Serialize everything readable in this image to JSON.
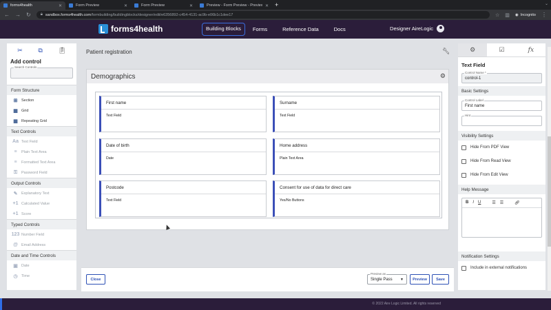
{
  "browser": {
    "tabs": [
      {
        "title": "forms4health",
        "active": true
      },
      {
        "title": "Form Preview",
        "active": false
      },
      {
        "title": "Form Preview",
        "active": false
      },
      {
        "title": "Preview - Form Preview - Preview",
        "active": false
      }
    ],
    "url_host": "sandbox.forms4health.com",
    "url_path": "/formbuilding/buildingblocks/designer/edit/e6356892-c454-4131-ac9b-e06b1c1dee17",
    "incognito_label": "Incognito"
  },
  "header": {
    "logo_text": "forms4health",
    "nav": [
      {
        "label": "Building Blocks",
        "active": true
      },
      {
        "label": "Forms",
        "active": false
      },
      {
        "label": "Reference Data",
        "active": false
      },
      {
        "label": "Docs",
        "active": false
      }
    ],
    "user_label": "Designer AireLogic"
  },
  "left": {
    "title": "Add control",
    "search_label": "Search Controls",
    "sections": [
      {
        "title": "Form Structure",
        "items": [
          {
            "label": "Section",
            "icon": "section-icon",
            "glyph": "⊞",
            "enabled": true
          },
          {
            "label": "Grid",
            "icon": "grid-icon",
            "glyph": "▦",
            "enabled": true
          },
          {
            "label": "Repeating Grid",
            "icon": "repeating-grid-icon",
            "glyph": "▦",
            "enabled": true
          }
        ]
      },
      {
        "title": "Text Controls",
        "items": [
          {
            "label": "Text Field",
            "icon": "text-field-icon",
            "glyph": "Aa",
            "enabled": false
          },
          {
            "label": "Plain Text Area",
            "icon": "plain-text-area-icon",
            "glyph": "≡",
            "enabled": false
          },
          {
            "label": "Formatted Text Area",
            "icon": "formatted-text-area-icon",
            "glyph": "≡",
            "enabled": false
          },
          {
            "label": "Password Field",
            "icon": "password-field-icon",
            "glyph": "⚿",
            "enabled": false
          }
        ]
      },
      {
        "title": "Output Controls",
        "items": [
          {
            "label": "Explanatory Text",
            "icon": "explanatory-text-icon",
            "glyph": "✎",
            "enabled": false
          },
          {
            "label": "Calculated Value",
            "icon": "calculated-value-icon",
            "glyph": "+1",
            "enabled": false
          },
          {
            "label": "Score",
            "icon": "score-icon",
            "glyph": "+1",
            "enabled": false
          }
        ]
      },
      {
        "title": "Typed Controls",
        "items": [
          {
            "label": "Number Field",
            "icon": "number-field-icon",
            "glyph": "123",
            "enabled": false
          },
          {
            "label": "Email Address",
            "icon": "email-address-icon",
            "glyph": "@",
            "enabled": false
          }
        ]
      },
      {
        "title": "Date and Time Controls",
        "items": [
          {
            "label": "Date",
            "icon": "date-icon",
            "glyph": "▣",
            "enabled": false
          },
          {
            "label": "Time",
            "icon": "time-icon",
            "glyph": "◷",
            "enabled": false
          }
        ]
      }
    ]
  },
  "main": {
    "title": "Patient registration",
    "section_title": "Demographics",
    "fields": [
      {
        "label": "First name",
        "type": "Text Field"
      },
      {
        "label": "Surname",
        "type": "Text Field"
      },
      {
        "label": "Date of birth",
        "type": "Date"
      },
      {
        "label": "Home address",
        "type": "Plain Text Area"
      },
      {
        "label": "Postcode",
        "type": "Text Field"
      },
      {
        "label": "Consent for use of data for direct care",
        "type": "Yes/No Buttons"
      }
    ]
  },
  "bottom": {
    "close_label": "Close",
    "preview_as_label": "Preview as",
    "preview_as_value": "Single Pass",
    "preview_label": "Preview",
    "save_label": "Save"
  },
  "right": {
    "heading": "Text Field",
    "control_name_label": "Control Name *",
    "control_name_value": "control-1",
    "basic_settings": "Basic Settings",
    "control_label_label": "Control Label",
    "control_label_value": "First name",
    "hint_label": "Hint",
    "hint_value": "",
    "visibility_settings": "Visibility Settings",
    "visibility": [
      "Hide From PDF View",
      "Hide From Read View",
      "Hide From Edit View"
    ],
    "help_message": "Help Message",
    "notification_settings": "Notification Settings",
    "notification_option": "Include in external notifications"
  },
  "footer": {
    "copyright": "© 2022 Aire Logic Limited. All rights reserved"
  },
  "colors": {
    "header_bg": "#2b1d3a",
    "accent": "#3b4fb8",
    "link_blue": "#2b4fb5"
  }
}
